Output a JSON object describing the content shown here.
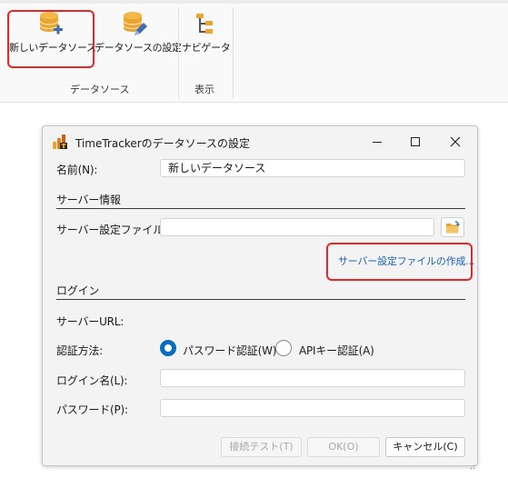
{
  "ribbon": {
    "buttons": [
      {
        "label": "新しいデータソース",
        "icon": "database-add-icon"
      },
      {
        "label": "データソースの設定",
        "icon": "database-edit-icon"
      },
      {
        "label": "ナビゲータ",
        "icon": "navigator-tree-icon"
      }
    ],
    "groups": [
      "データソース",
      "表示"
    ]
  },
  "dialog": {
    "title": "TimeTrackerのデータソースの設定",
    "name_label": "名前(N):",
    "name_value": "新しいデータソース",
    "server_section": "サーバー情報",
    "server_file_label": "サーバー設定ファイル(F):",
    "server_file_value": "",
    "create_server_file_link": "サーバー設定ファイルの作成...",
    "login_section": "ログイン",
    "server_url_label": "サーバーURL:",
    "auth_label": "認証方法:",
    "auth_options": [
      {
        "label": "パスワード認証(W)",
        "selected": true
      },
      {
        "label": "APIキー認証(A)",
        "selected": false
      }
    ],
    "login_name_label": "ログイン名(L):",
    "login_name_value": "",
    "password_label": "パスワード(P):",
    "password_value": "",
    "buttons": {
      "test": "接続テスト(T)",
      "ok": "OK(O)",
      "cancel": "キャンセル(C)"
    }
  },
  "colors": {
    "accent": "#0a6cbe",
    "highlight": "#e8262a",
    "link": "#1a64b4",
    "icon_gold": "#e8a530"
  }
}
